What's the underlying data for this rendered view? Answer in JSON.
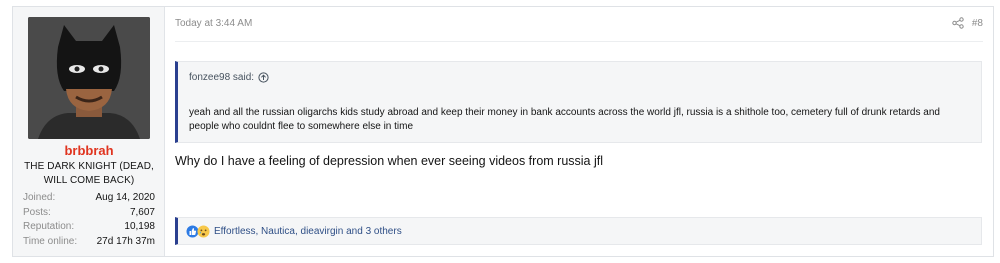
{
  "post": {
    "date": "Today at 3:44 AM",
    "number": "#8"
  },
  "user": {
    "name": "brbbrah",
    "title": "THE DARK KNIGHT (DEAD, WILL COME BACK)",
    "stats": [
      {
        "label": "Joined:",
        "value": "Aug 14, 2020"
      },
      {
        "label": "Posts:",
        "value": "7,607"
      },
      {
        "label": "Reputation:",
        "value": "10,198"
      },
      {
        "label": "Time online:",
        "value": "27d 17h 37m"
      }
    ]
  },
  "quote": {
    "attribution": "fonzee98 said:",
    "text": "yeah and all the russian oligarchs kids study abroad and keep their money in bank accounts across the world jfl, russia is a shithole too, cemetery full of drunk retards and people who couldnt flee to somewhere else in time"
  },
  "message": "Why do I have a feeling of depression when ever seeing videos from russia jfl",
  "reactions": {
    "text": "Effortless, Nautica, dieavirgin and 3 others",
    "icons": [
      "like-icon",
      "sad-icon"
    ]
  },
  "colors": {
    "username": "#e0341f",
    "accent_bar": "#2a3f8f",
    "reaction_link": "#2f4f86"
  }
}
